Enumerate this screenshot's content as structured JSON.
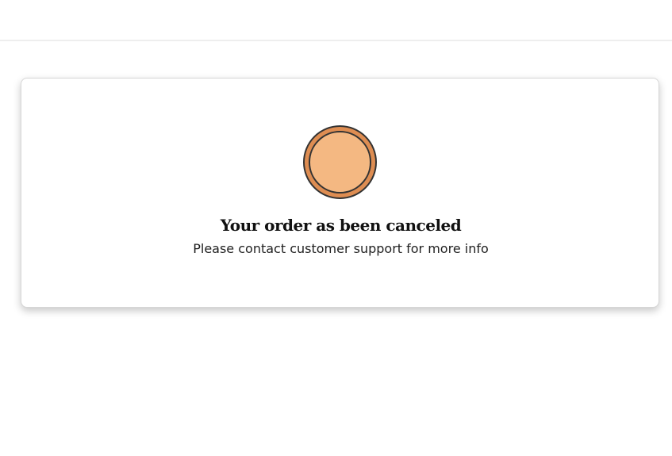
{
  "status_card": {
    "icon": "status-circle-icon",
    "title": "Your order as been canceled",
    "message": "Please contact customer support for more info"
  },
  "colors": {
    "icon_outer": "#de8d52",
    "icon_inner": "#f4b882",
    "icon_outline": "#333333"
  }
}
